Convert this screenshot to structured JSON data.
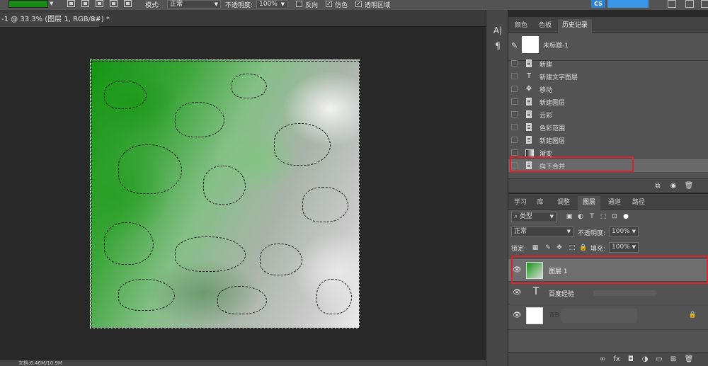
{
  "options_bar": {
    "foreground_color": "#1a8a16",
    "mode_label": "模式:",
    "mode_value": "正常",
    "opacity_label": "不透明度:",
    "opacity_value": "100%",
    "reverse_label": "反向",
    "dither_label": "仿色",
    "transparency_label": "透明区域",
    "cloud_badge": "CS"
  },
  "document": {
    "tab_title": "-1 @ 33.3% (图层 1, RGB/8#) *",
    "close_glyph": "×",
    "status_text": "文档:6.46M/10.9M"
  },
  "side_strip": {
    "icons": [
      "A|",
      "¶"
    ]
  },
  "history_panel": {
    "tabs": [
      {
        "label": "颜色",
        "active": false
      },
      {
        "label": "色板",
        "active": false
      },
      {
        "label": "历史记录",
        "active": true
      }
    ],
    "snapshot_label": "未标题-1",
    "items": [
      {
        "label": "新建",
        "icon": "doc-icon"
      },
      {
        "label": "新建文字图层",
        "icon": "type-icon"
      },
      {
        "label": "移动",
        "icon": "move-icon"
      },
      {
        "label": "新建图层",
        "icon": "doc-icon"
      },
      {
        "label": "云彩",
        "icon": "doc-icon"
      },
      {
        "label": "色彩范围",
        "icon": "doc-icon"
      },
      {
        "label": "新建图层",
        "icon": "doc-icon"
      },
      {
        "label": "渐变",
        "icon": "gradient-icon"
      },
      {
        "label": "向下合并",
        "icon": "doc-icon",
        "current": true
      }
    ]
  },
  "layers_panel": {
    "tabs": [
      {
        "label": "学习",
        "active": false
      },
      {
        "label": "库",
        "active": false
      },
      {
        "label": "调整",
        "active": false
      },
      {
        "label": "图层",
        "active": true
      },
      {
        "label": "通道",
        "active": false
      },
      {
        "label": "路径",
        "active": false
      }
    ],
    "filter_kind": "类型",
    "blend_mode": "正常",
    "opacity_label": "不透明度:",
    "opacity_value": "100%",
    "lock_label": "锁定:",
    "fill_label": "填充:",
    "fill_value": "100%",
    "layers": [
      {
        "name": "图层 1",
        "kind": "pixel",
        "selected": true
      },
      {
        "name": "百度经验",
        "kind": "text",
        "selected": false
      },
      {
        "name": "背景",
        "kind": "background",
        "selected": false
      }
    ]
  },
  "colors": {
    "highlight_box": "#e0202c"
  }
}
